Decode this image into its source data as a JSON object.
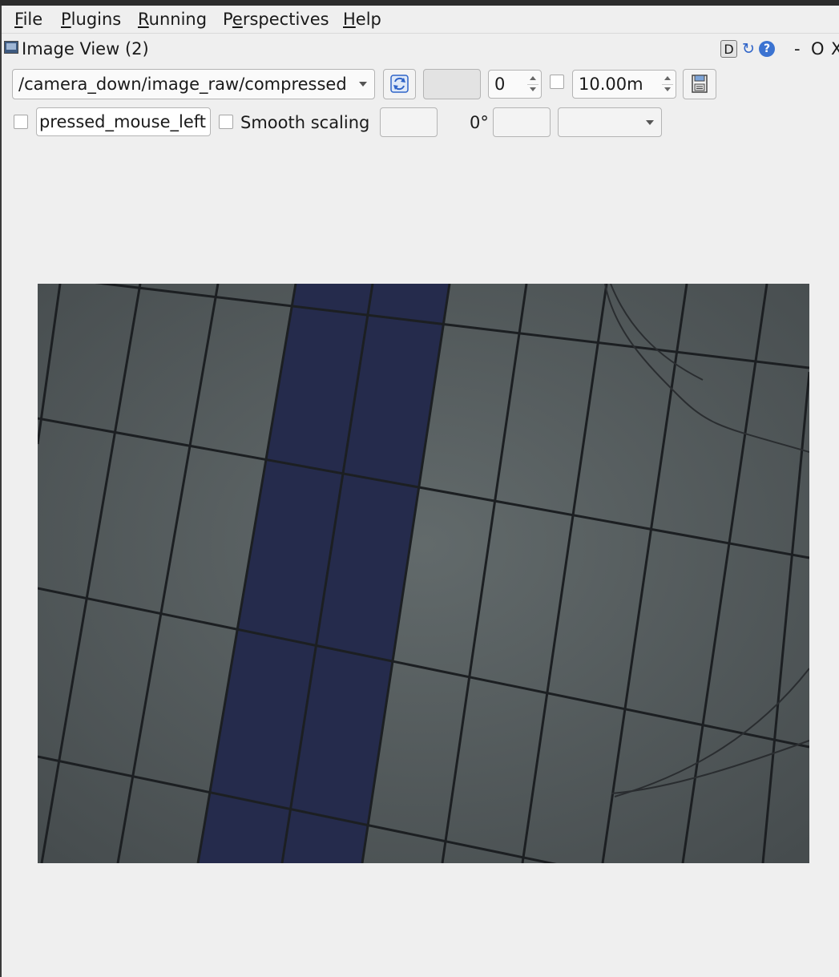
{
  "menubar": {
    "items": [
      {
        "mnemonic": "F",
        "rest": "ile"
      },
      {
        "mnemonic": "P",
        "rest": "lugins"
      },
      {
        "mnemonic": "R",
        "rest": "unning"
      },
      {
        "prefix": "P",
        "mnemonic": "e",
        "rest": "rspectives"
      },
      {
        "mnemonic": "H",
        "rest": "elp"
      }
    ]
  },
  "window": {
    "title": "Image View (2)",
    "buttons": {
      "d": "D",
      "help": "?",
      "minimize": "-",
      "maximize": "O",
      "close": "X"
    }
  },
  "toolbar": {
    "topic": "/camera_down/image_raw/compressed",
    "spin_value": "0",
    "duration": "10.00m"
  },
  "toolbar2": {
    "mouse_topic": "pressed_mouse_left",
    "smooth_label": "Smooth scaling",
    "rotation_label": "0°"
  },
  "icons": {
    "refresh": "refresh-icon",
    "save": "save-icon",
    "window": "window-icon"
  },
  "image": {
    "description_colors": {
      "tile": "#5a6062",
      "stripe": "#23294a",
      "grout": "#1c1e20"
    }
  }
}
